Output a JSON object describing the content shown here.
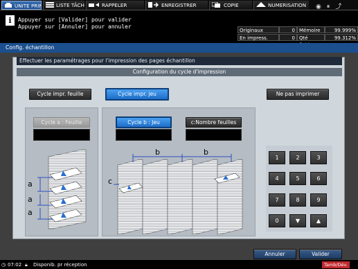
{
  "tabs": [
    {
      "label": "UNITE PRINC.",
      "active": true
    },
    {
      "label": "LISTE TÂCHES"
    },
    {
      "label": "RAPPELER"
    },
    {
      "label": "ENREGISTRER"
    },
    {
      "label": "COPIE"
    },
    {
      "label": "NUMERISATION"
    }
  ],
  "message": {
    "line1": "Appuyer sur [Valider] pour valider",
    "line2": "Appuyer sur [Annuler] pour annuler"
  },
  "counters": {
    "originaux_label": "Originaux",
    "originaux_value": "0",
    "memoire_label": "Mémoire",
    "memoire_value": "99.999%",
    "en_impress_label": "En impress.",
    "en_impress_value": "0",
    "qte_fichier_label": "Qté fichier",
    "qte_fichier_value": "99.312%"
  },
  "dialog": {
    "title": "Config. échantillon",
    "instruction": "Effectuer les paramétrages pour l'impression des pages échantillon",
    "section_title": "Configuration du cycle d'impression",
    "btn_cycle_feuille": "Cycle impr. feuille",
    "btn_cycle_jeu": "Cycle impr. jeu",
    "btn_ne_pas_imprimer": "Ne pas imprimer",
    "btn_cycle_a": "Cycle a : Feuille",
    "btn_cycle_b": "Cycle b : Jeu",
    "btn_nombre_feuilles": "c:Nombre feuilles",
    "label_a": "a",
    "label_b": "b",
    "label_c": "c",
    "btn_annuler": "Annuler",
    "btn_valider": "Valider"
  },
  "keypad": [
    "1",
    "2",
    "3",
    "4",
    "5",
    "6",
    "7",
    "8",
    "9",
    "0",
    "▼",
    "▲"
  ],
  "status": {
    "time": "07:02",
    "text": "Disponib. pr réception",
    "right": "Tamb/Dév."
  },
  "colors": {
    "accent": "#1d6dc8",
    "title_bar": "#1b4f8e"
  }
}
